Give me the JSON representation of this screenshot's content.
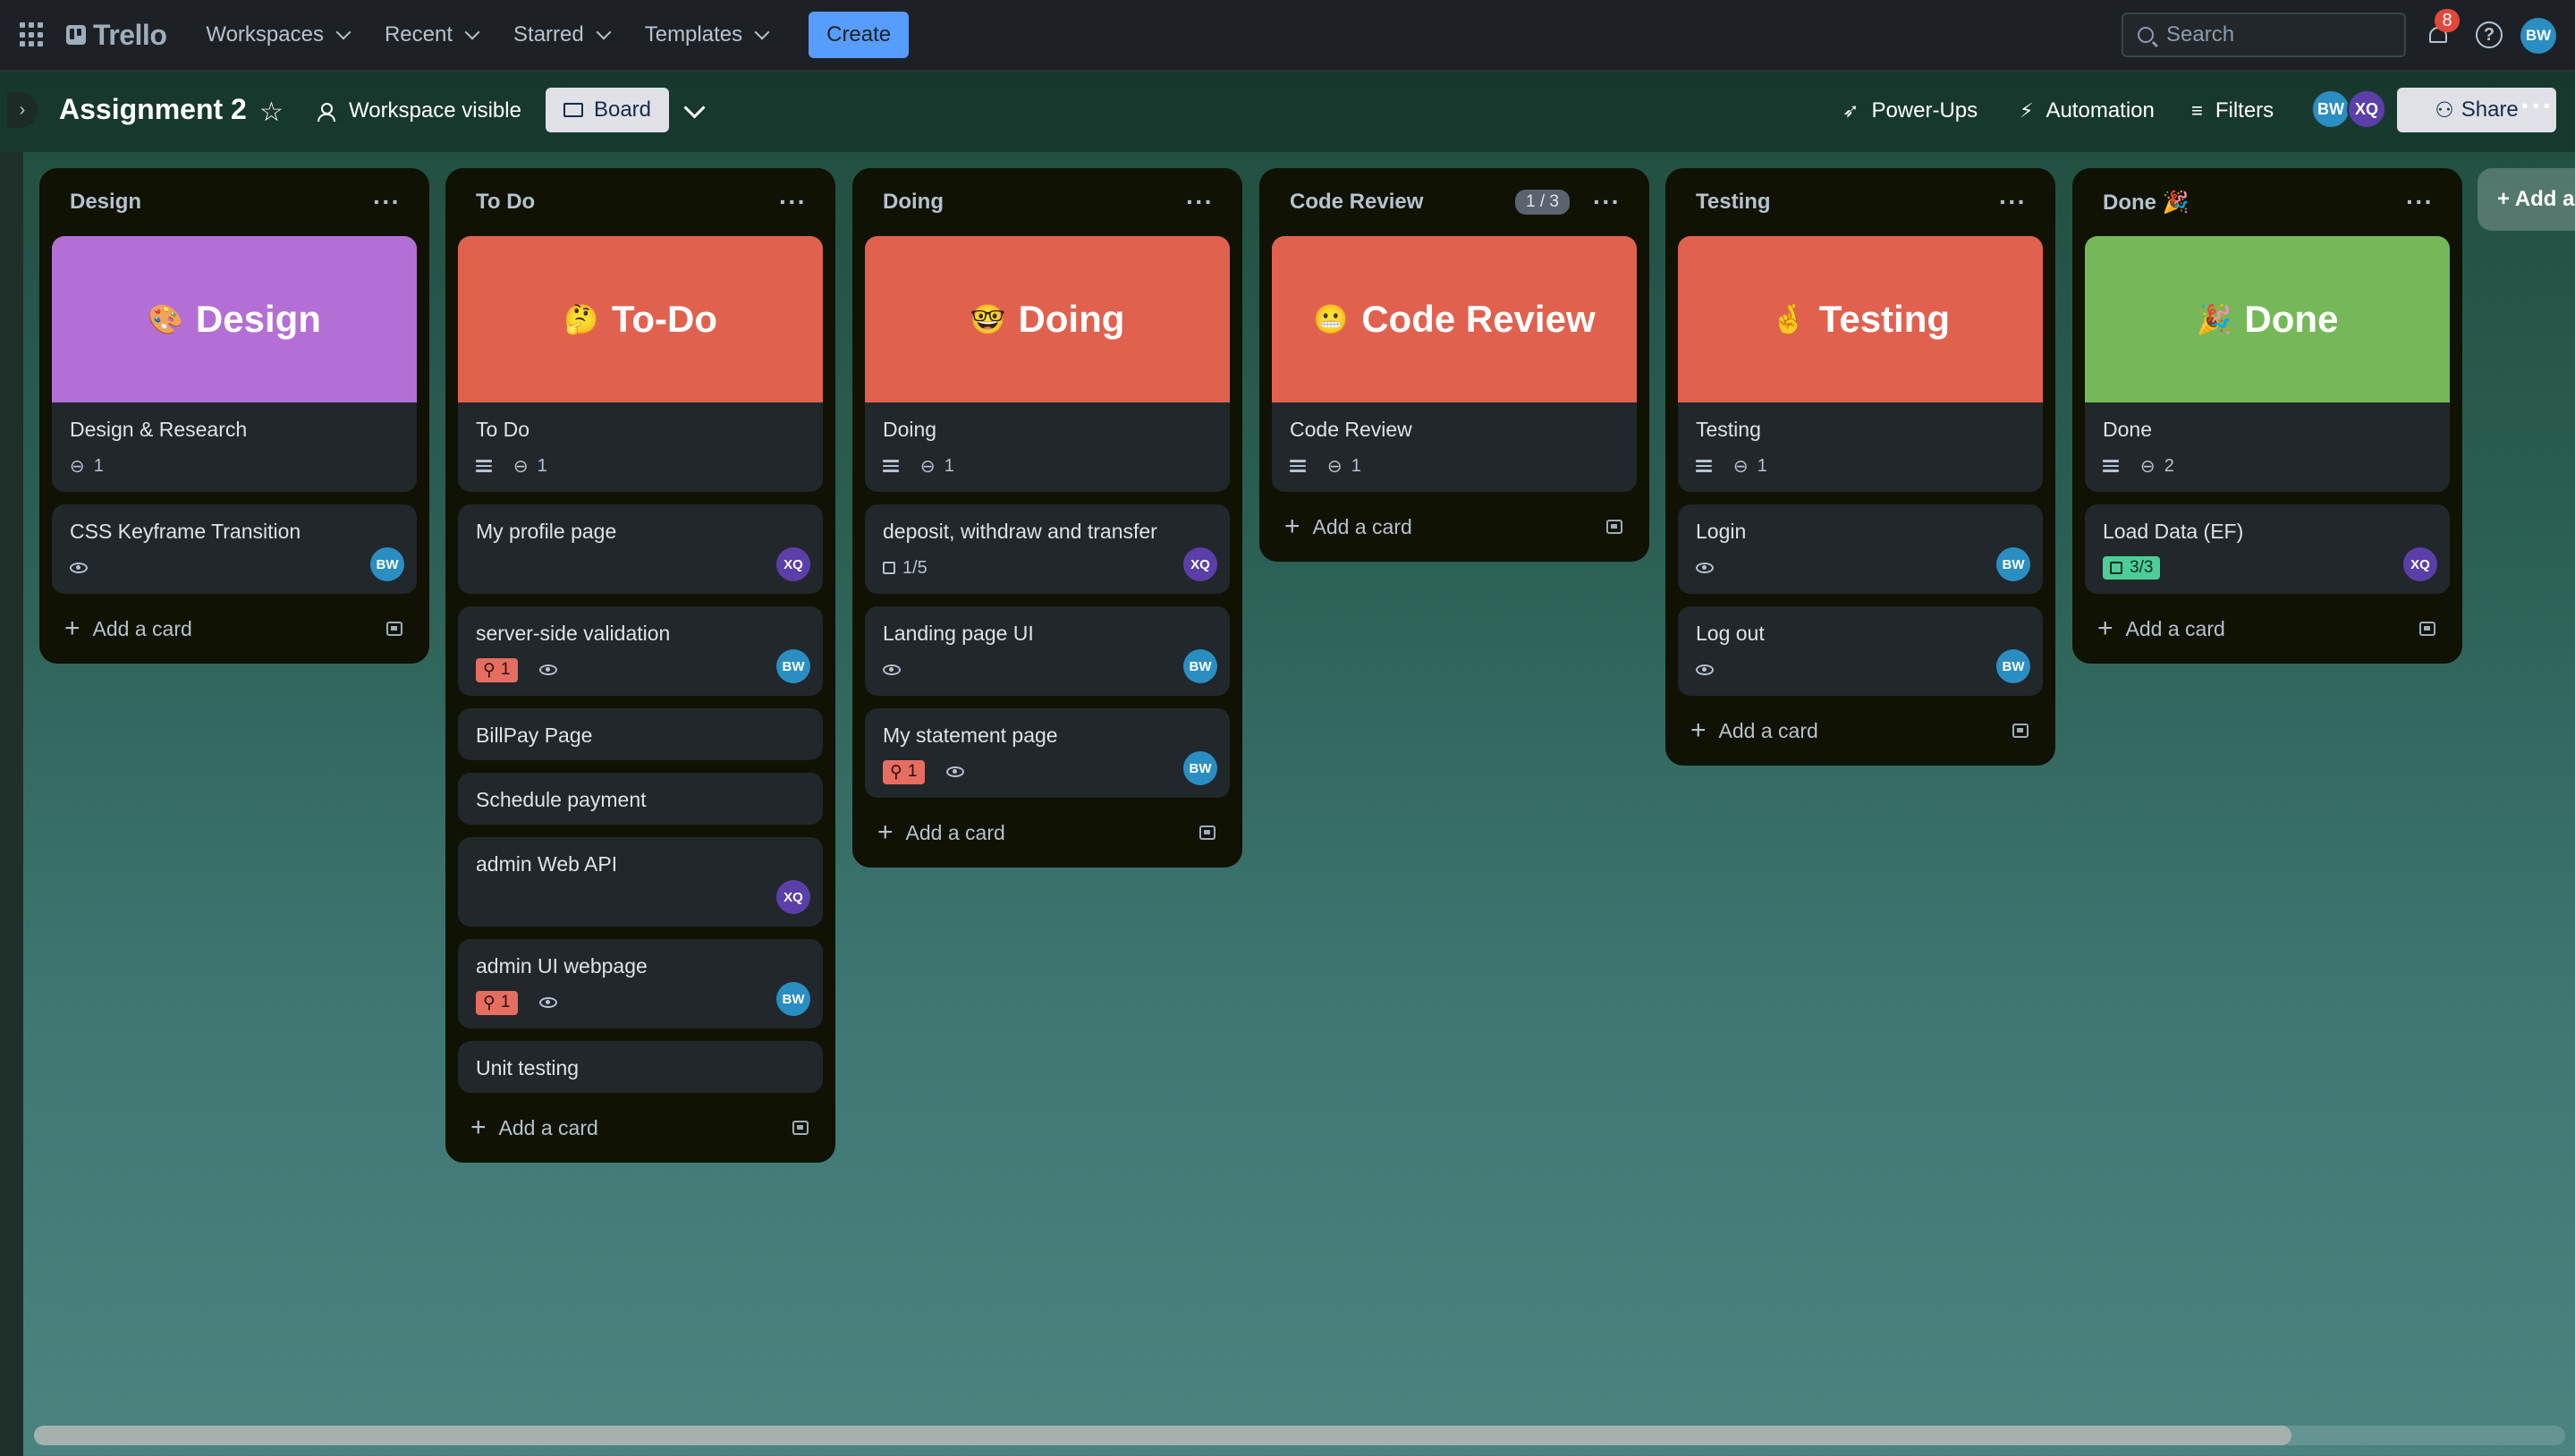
{
  "nav": {
    "logo": "Trello",
    "menus": [
      "Workspaces",
      "Recent",
      "Starred",
      "Templates"
    ],
    "create_label": "Create",
    "search_placeholder": "Search",
    "notification_count": "8",
    "help": "?",
    "user_initials": "BW"
  },
  "board": {
    "title": "Assignment 2",
    "visibility": "Workspace visible",
    "view": "Board",
    "powerups": "Power-Ups",
    "automation": "Automation",
    "filters": "Filters",
    "members": [
      "BW",
      "XQ"
    ],
    "share": "Share",
    "add_list": "+ Add a"
  },
  "colors": {
    "purple": "#b46fd6",
    "orange": "#e1614f",
    "green": "#76b859",
    "bw": "#2a8ec2",
    "xq": "#5b3fa8"
  },
  "lists": [
    {
      "title": "Design",
      "cover": {
        "emoji": "🎨",
        "text": "Design"
      },
      "cards": [
        {
          "title": "Design & Research",
          "attachments": "1"
        },
        {
          "title": "CSS Keyframe Transition",
          "watch": true,
          "member": "BW"
        }
      ],
      "add": "Add a card"
    },
    {
      "title": "To Do",
      "cover": {
        "emoji": "🤔",
        "text": "To-Do"
      },
      "cards": [
        {
          "title": "To Do",
          "description": true,
          "attachments": "1"
        },
        {
          "title": "My profile page",
          "member": "XQ"
        },
        {
          "title": "server-side validation",
          "priority": "1",
          "watch": true,
          "member": "BW"
        },
        {
          "title": "BillPay Page"
        },
        {
          "title": "Schedule payment"
        },
        {
          "title": "admin Web API",
          "member": "XQ"
        },
        {
          "title": "admin UI webpage",
          "priority": "1",
          "watch": true,
          "member": "BW"
        },
        {
          "title": "Unit testing"
        }
      ],
      "add": "Add a card"
    },
    {
      "title": "Doing",
      "cover": {
        "emoji": "🤓",
        "text": "Doing"
      },
      "cards": [
        {
          "title": "Doing",
          "description": true,
          "attachments": "1"
        },
        {
          "title": "deposit, withdraw and transfer",
          "checklist": "1/5",
          "member": "XQ"
        },
        {
          "title": "Landing page UI",
          "watch": true,
          "member": "BW"
        },
        {
          "title": "My statement page",
          "priority": "1",
          "watch": true,
          "member": "BW"
        }
      ],
      "add": "Add a card"
    },
    {
      "title": "Code Review",
      "count": "1 / 3",
      "cover": {
        "emoji": "😬",
        "text": "Code Review"
      },
      "cards": [
        {
          "title": "Code Review",
          "description": true,
          "attachments": "1"
        }
      ],
      "add": "Add a card"
    },
    {
      "title": "Testing",
      "cover": {
        "emoji": "🤞",
        "text": "Testing"
      },
      "cards": [
        {
          "title": "Testing",
          "description": true,
          "attachments": "1"
        },
        {
          "title": "Login",
          "watch": true,
          "member": "BW"
        },
        {
          "title": "Log out",
          "watch": true,
          "member": "BW"
        }
      ],
      "add": "Add a card"
    },
    {
      "title": "Done 🎉",
      "cover": {
        "emoji": "🎉",
        "text": "Done"
      },
      "cards": [
        {
          "title": "Done",
          "description": true,
          "attachments": "2"
        },
        {
          "title": "Load Data (EF)",
          "checklist_done": "3/3",
          "member": "XQ"
        }
      ],
      "add": "Add a card"
    }
  ]
}
